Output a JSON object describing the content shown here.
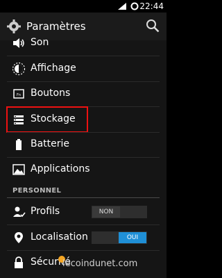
{
  "status_bar": {
    "time": "22:44"
  },
  "action_bar": {
    "title": "Paramètres"
  },
  "items": [
    {
      "label": "Son",
      "icon": "volume-icon"
    },
    {
      "label": "Affichage",
      "icon": "brightness-icon"
    },
    {
      "label": "Boutons",
      "icon": "buttons-icon"
    },
    {
      "label": "Stockage",
      "icon": "storage-icon"
    },
    {
      "label": "Batterie",
      "icon": "battery-icon"
    },
    {
      "label": "Applications",
      "icon": "applications-icon"
    }
  ],
  "section": {
    "title": "PERSONNEL"
  },
  "personal_items": [
    {
      "label": "Profils",
      "icon": "profiles-icon",
      "toggle": "NON"
    },
    {
      "label": "Localisation",
      "icon": "location-icon",
      "toggle": "OUI"
    },
    {
      "label": "Sécurité",
      "icon": "lock-icon"
    }
  ],
  "watermark": {
    "text": "lecoindunet.com"
  },
  "colors": {
    "highlight": "#ee1111",
    "toggle_on": "#1f8fd6",
    "background": "#151515"
  }
}
